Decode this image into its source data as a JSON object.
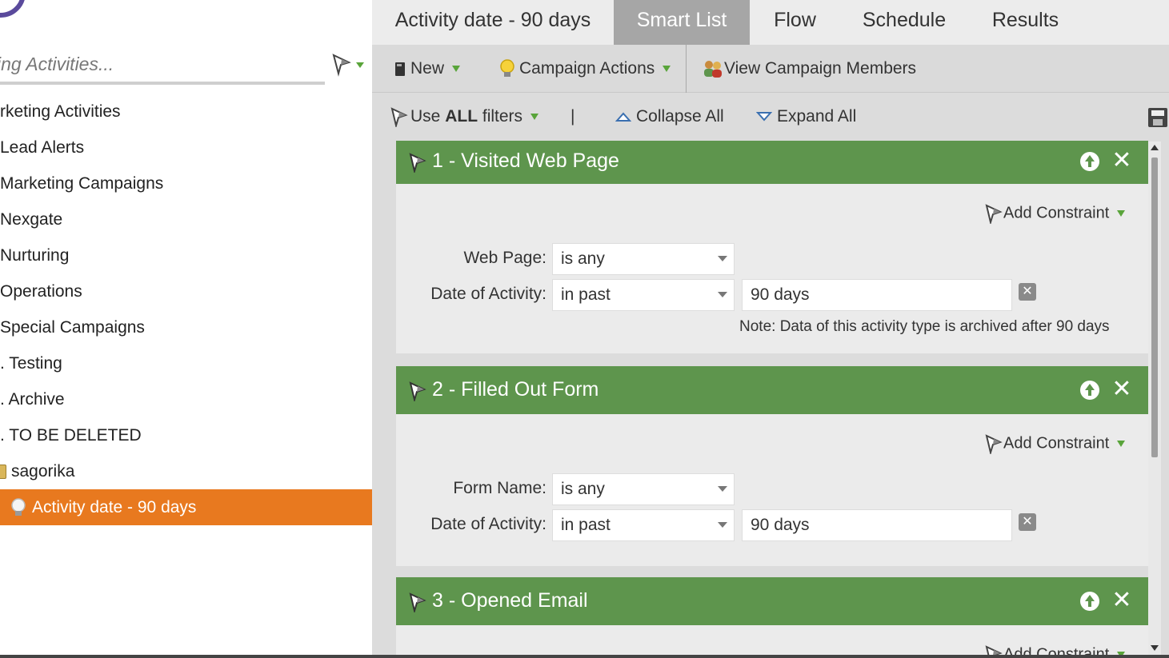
{
  "sidebar": {
    "search_placeholder": "ing Activities...",
    "items": [
      {
        "label": "rketing Activities"
      },
      {
        "label": "Lead Alerts"
      },
      {
        "label": "Marketing Campaigns"
      },
      {
        "label": "Nexgate"
      },
      {
        "label": "Nurturing"
      },
      {
        "label": "Operations"
      },
      {
        "label": "Special Campaigns"
      },
      {
        "label": ". Testing"
      },
      {
        "label": ". Archive"
      },
      {
        "label": ". TO BE DELETED"
      },
      {
        "label": "sagorika"
      },
      {
        "label": "Activity date - 90 days"
      }
    ]
  },
  "tabs": [
    {
      "label": "Activity date - 90 days"
    },
    {
      "label": "Smart List"
    },
    {
      "label": "Flow"
    },
    {
      "label": "Schedule"
    },
    {
      "label": "Results"
    }
  ],
  "toolbar": {
    "new_label": "New",
    "campaign_actions_label": "Campaign Actions",
    "view_members_label": "View Campaign Members"
  },
  "filterbar": {
    "use_prefix": "Use",
    "use_bold": "ALL",
    "use_suffix": "filters",
    "divider": "|",
    "collapse_label": "Collapse All",
    "expand_label": "Expand All"
  },
  "filters": [
    {
      "title": "1 - Visited Web Page",
      "add_constraint": "Add Constraint",
      "rows": [
        {
          "label": "Web Page:",
          "operator": "is any"
        },
        {
          "label": "Date of Activity:",
          "operator": "in past",
          "value": "90 days"
        }
      ],
      "note": "Note: Data of this activity type is archived after 90 days"
    },
    {
      "title": "2 - Filled Out Form",
      "add_constraint": "Add Constraint",
      "rows": [
        {
          "label": "Form Name:",
          "operator": "is any"
        },
        {
          "label": "Date of Activity:",
          "operator": "in past",
          "value": "90 days"
        }
      ]
    },
    {
      "title": "3 - Opened Email",
      "add_constraint": "Add Constraint"
    }
  ],
  "colors": {
    "accent_orange": "#e8791f",
    "filter_green": "#5e954d",
    "caret_green": "#59a43a"
  }
}
